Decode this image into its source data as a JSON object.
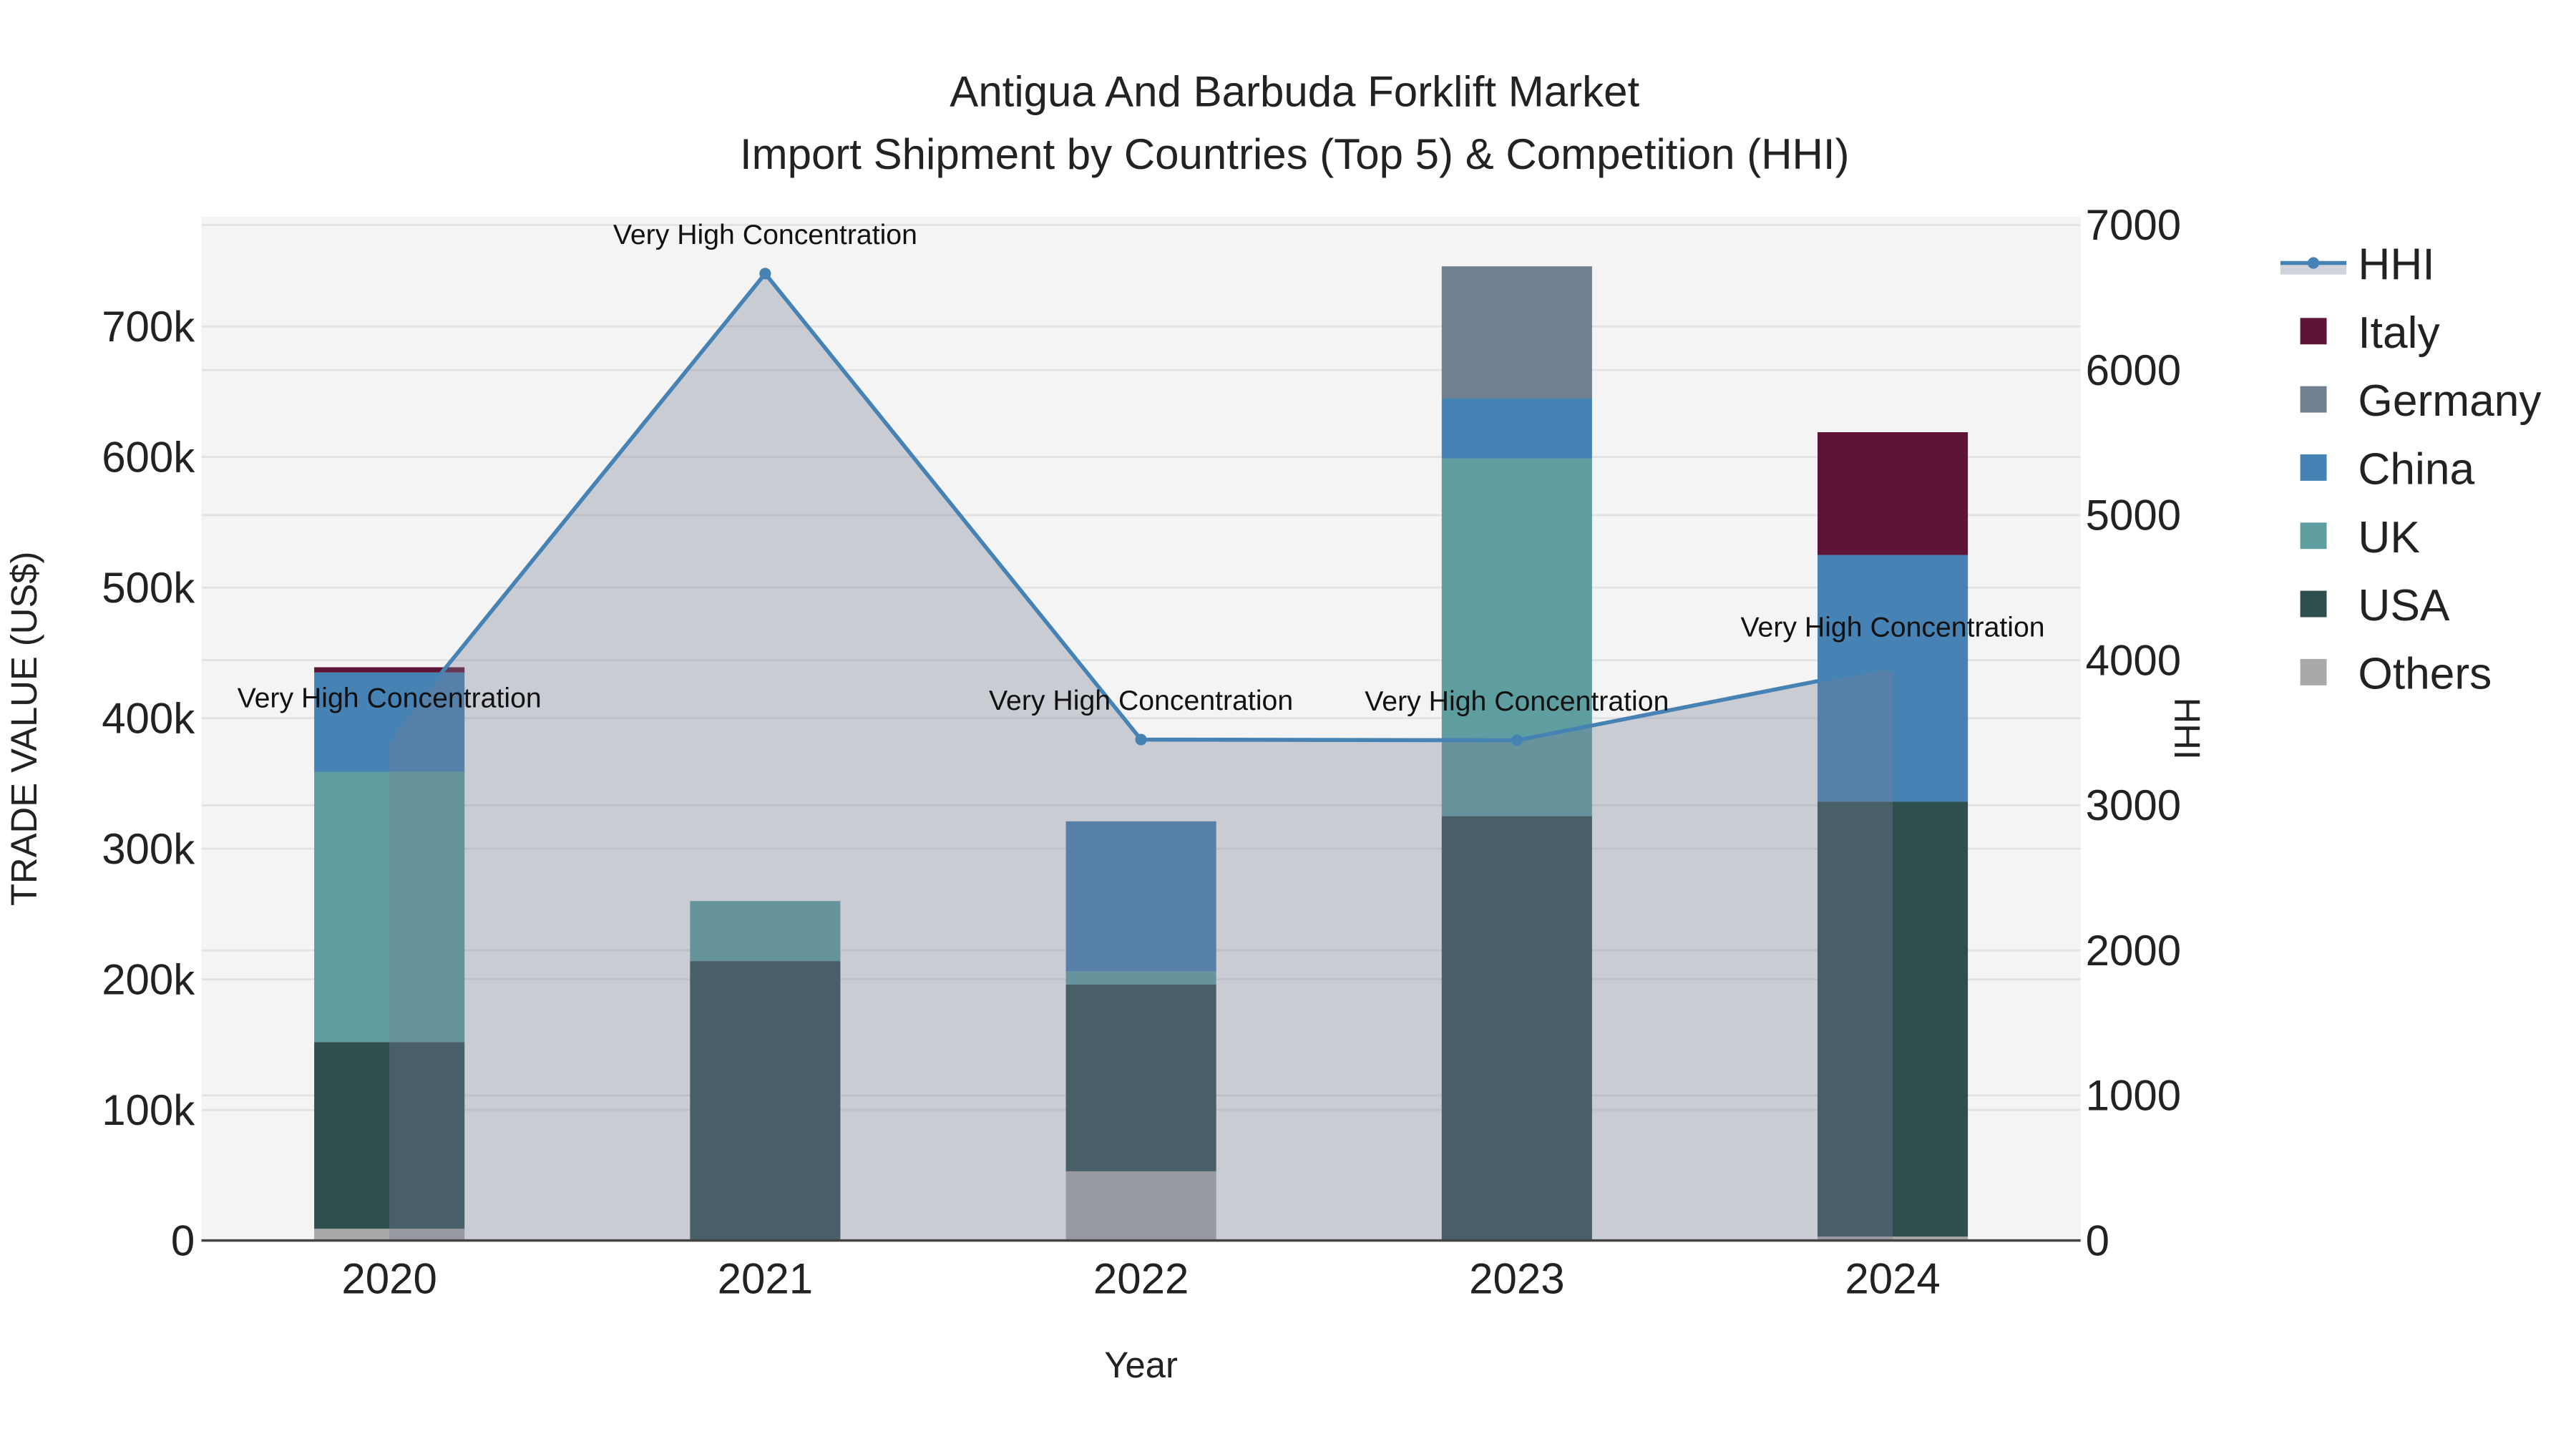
{
  "chart_data": {
    "type": "bar",
    "title": "Antigua And Barbuda Forklift Market",
    "subtitle": "Import Shipment by Countries (Top 5) & Competition (HHI)",
    "xlabel": "Year",
    "ylabel": "TRADE VALUE (US$)",
    "y2label": "HHI",
    "categories": [
      "2020",
      "2021",
      "2022",
      "2023",
      "2024"
    ],
    "ylim": [
      0,
      784000
    ],
    "y2lim": [
      0,
      7057
    ],
    "yticks": [
      0,
      100000,
      200000,
      300000,
      400000,
      500000,
      600000,
      700000
    ],
    "yticklabels": [
      "0",
      "100k",
      "200k",
      "300k",
      "400k",
      "500k",
      "600k",
      "700k"
    ],
    "y2ticks": [
      0,
      1000,
      2000,
      3000,
      4000,
      5000,
      6000,
      7000
    ],
    "y2ticklabels": [
      "0",
      "1000",
      "2000",
      "3000",
      "4000",
      "5000",
      "6000",
      "7000"
    ],
    "grid": true,
    "legend_position": "right",
    "stacked": true,
    "series": [
      {
        "name": "Others",
        "color": "#a9a9a9",
        "values": [
          9000,
          0,
          53000,
          0,
          3000
        ]
      },
      {
        "name": "USA",
        "color": "#2f4f4f",
        "values": [
          143000,
          214000,
          143000,
          325000,
          333000
        ]
      },
      {
        "name": "UK",
        "color": "#5f9ea0",
        "values": [
          207000,
          46000,
          10000,
          274000,
          0
        ]
      },
      {
        "name": "China",
        "color": "#4682b4",
        "values": [
          76000,
          0,
          115000,
          46000,
          189000
        ]
      },
      {
        "name": "Germany",
        "color": "#708090",
        "values": [
          0,
          0,
          0,
          101000,
          0
        ]
      },
      {
        "name": "Italy",
        "color": "#5e1436",
        "values": [
          4000,
          0,
          0,
          0,
          94000
        ]
      }
    ],
    "line": {
      "name": "HHI",
      "color": "#4682b4",
      "axis": "right",
      "values": [
        3470,
        6665,
        3453,
        3448,
        3958
      ],
      "annotations": [
        "Very High Concentration",
        "Very High Concentration",
        "Very High Concentration",
        "Very High Concentration",
        "Very High Concentration"
      ]
    },
    "legend": [
      "HHI",
      "Italy",
      "Germany",
      "China",
      "UK",
      "USA",
      "Others"
    ]
  }
}
